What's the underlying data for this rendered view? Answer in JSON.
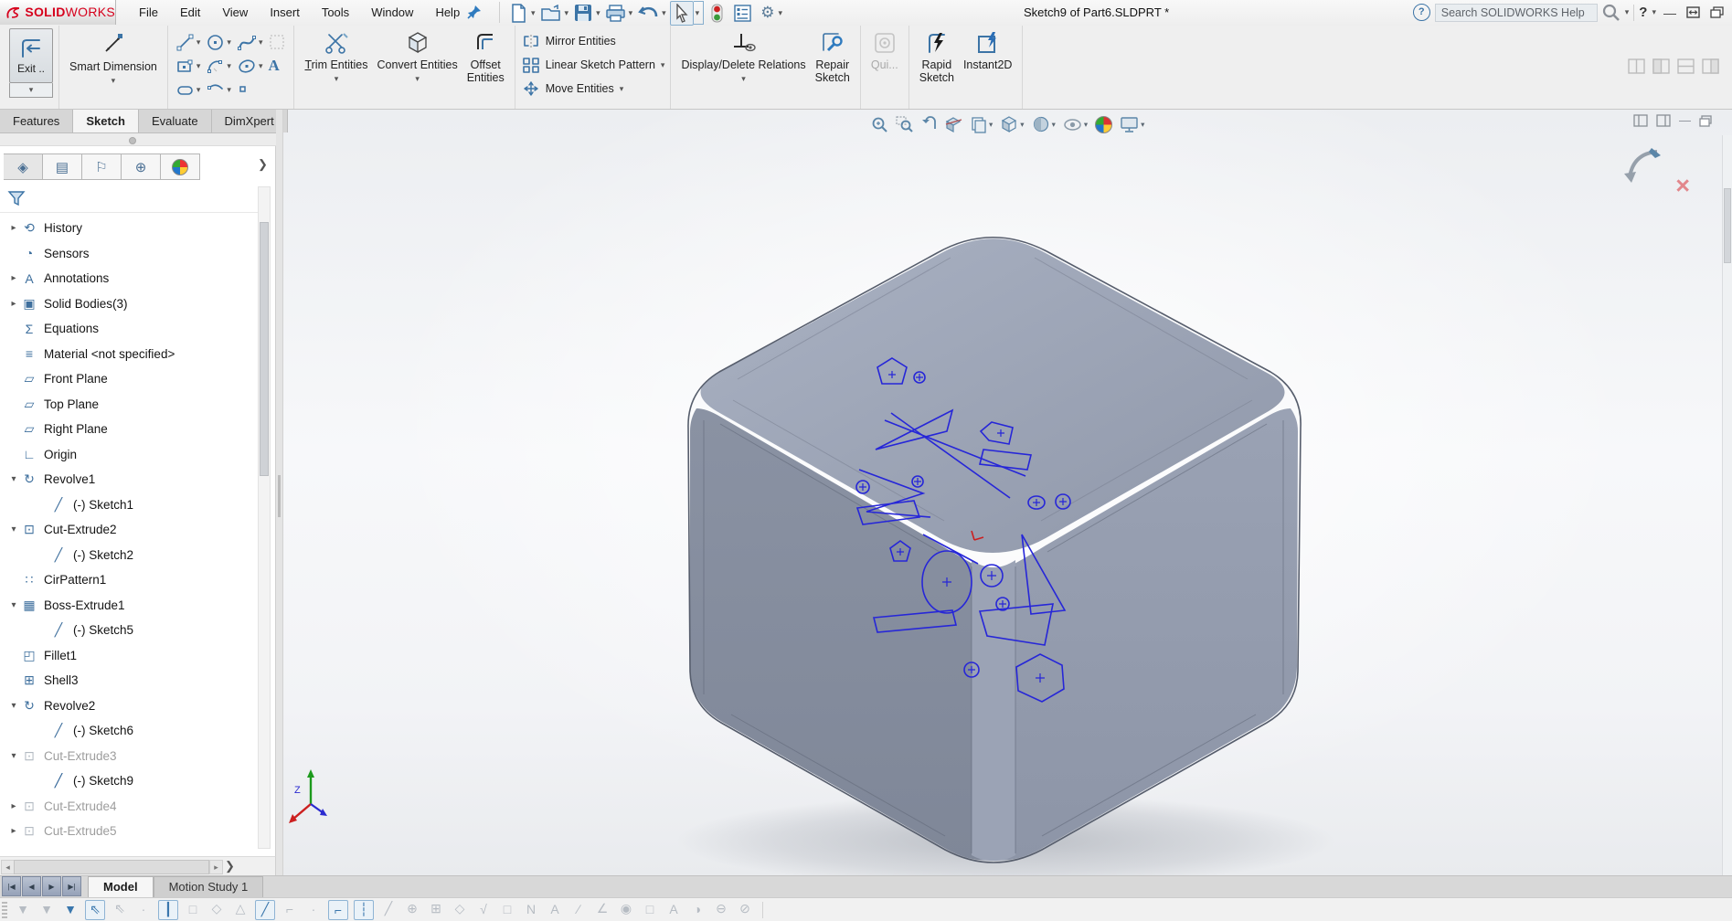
{
  "colors": {
    "logo_red": "#d6001c",
    "icon_blue": "#3c74a6",
    "sketch_blue": "#2626d8",
    "model_gray": "#929aac",
    "accent": "#2a78bd"
  },
  "titlebar": {
    "logo_solid": "SOLID",
    "logo_works": "WORKS",
    "menus": [
      "File",
      "Edit",
      "View",
      "Insert",
      "Tools",
      "Window",
      "Help"
    ],
    "title": "Sketch9 of Part6.SLDPRT *",
    "search_placeholder": "Search SOLIDWORKS Help",
    "help_mark": "?",
    "quickbar_icons": [
      "new",
      "open",
      "save",
      "print",
      "undo",
      "select-arrow",
      "rebuild-traffic-light",
      "file-properties",
      "options-gear"
    ],
    "window_icons": [
      "minimize",
      "resize",
      "cascade-windows"
    ]
  },
  "ribbon": {
    "exit_label": "Exit ..",
    "smart_dimension": "Smart Dimension",
    "trim": "Trim Entities",
    "convert": "Convert Entities",
    "offset_line1": "Offset",
    "offset_line2": "Entities",
    "mirror": "Mirror Entities",
    "linear_pattern": "Linear Sketch Pattern",
    "move": "Move Entities",
    "display_delete": "Display/Delete Relations",
    "repair_line1": "Repair",
    "repair_line2": "Sketch",
    "quick_snaps": "Qui...",
    "rapid_line1": "Rapid",
    "rapid_line2": "Sketch",
    "instant2d": "Instant2D",
    "right_icons": [
      "display-pane-1",
      "display-pane-2",
      "display-pane-3",
      "display-pane-4"
    ]
  },
  "cmd_tabs": [
    {
      "label": "Features",
      "cls": ""
    },
    {
      "label": "Sketch",
      "cls": "active"
    },
    {
      "label": "Evaluate",
      "cls": ""
    },
    {
      "label": "DimXpert",
      "cls": ""
    }
  ],
  "panel_tabs": [
    {
      "glyph": "◈",
      "name": "featuremanager-tab-icon",
      "cls": "sel"
    },
    {
      "glyph": "▤",
      "name": "propertymanager-tab-icon",
      "cls": ""
    },
    {
      "glyph": "⚐",
      "name": "configurationmanager-tab-icon",
      "cls": ""
    },
    {
      "glyph": "⊕",
      "name": "dimxpertmanager-tab-icon",
      "cls": ""
    },
    {
      "glyph": "",
      "name": "displaymanager-tab-icon",
      "cls": "ballt"
    }
  ],
  "tree": {
    "items": [
      {
        "arrow": "▸",
        "glyph": "⟲",
        "label": "History",
        "cls": ""
      },
      {
        "arrow": "",
        "glyph": "◔",
        "label": "Sensors",
        "cls": ""
      },
      {
        "arrow": "▸",
        "glyph": "A",
        "label": "Annotations",
        "cls": ""
      },
      {
        "arrow": "▸",
        "glyph": "▣",
        "label": "Solid Bodies(3)",
        "cls": ""
      },
      {
        "arrow": "",
        "glyph": "Σ",
        "label": "Equations",
        "cls": ""
      },
      {
        "arrow": "",
        "glyph": "≡",
        "label": "Material <not specified>",
        "cls": ""
      },
      {
        "arrow": "",
        "glyph": "▱",
        "label": "Front Plane",
        "cls": ""
      },
      {
        "arrow": "",
        "glyph": "▱",
        "label": "Top Plane",
        "cls": ""
      },
      {
        "arrow": "",
        "glyph": "▱",
        "label": "Right Plane",
        "cls": ""
      },
      {
        "arrow": "",
        "glyph": "∟",
        "label": "Origin",
        "cls": ""
      },
      {
        "arrow": "▾",
        "glyph": "↻",
        "label": "Revolve1",
        "cls": ""
      },
      {
        "arrow": "",
        "glyph": "╱",
        "label": "(-) Sketch1",
        "cls": "ind"
      },
      {
        "arrow": "▾",
        "glyph": "⊡",
        "label": "Cut-Extrude2",
        "cls": ""
      },
      {
        "arrow": "",
        "glyph": "╱",
        "label": "(-) Sketch2",
        "cls": "ind"
      },
      {
        "arrow": "",
        "glyph": "∷",
        "label": "CirPattern1",
        "cls": ""
      },
      {
        "arrow": "▾",
        "glyph": "▦",
        "label": "Boss-Extrude1",
        "cls": ""
      },
      {
        "arrow": "",
        "glyph": "╱",
        "label": "(-) Sketch5",
        "cls": "ind"
      },
      {
        "arrow": "",
        "glyph": "◰",
        "label": "Fillet1",
        "cls": ""
      },
      {
        "arrow": "",
        "glyph": "⊞",
        "label": "Shell3",
        "cls": ""
      },
      {
        "arrow": "▾",
        "glyph": "↻",
        "label": "Revolve2",
        "cls": ""
      },
      {
        "arrow": "",
        "glyph": "╱",
        "label": "(-) Sketch6",
        "cls": "ind"
      },
      {
        "arrow": "▾",
        "glyph": "⊡",
        "label": "Cut-Extrude3",
        "cls": "mut"
      },
      {
        "arrow": "",
        "glyph": "╱",
        "label": "(-) Sketch9",
        "cls": "ind edit"
      },
      {
        "arrow": "▸",
        "glyph": "⊡",
        "label": "Cut-Extrude4",
        "cls": "mut"
      },
      {
        "arrow": "▸",
        "glyph": "⊡",
        "label": "Cut-Extrude5",
        "cls": "mut"
      }
    ]
  },
  "headsup_icons": [
    "zoom-to-fit",
    "zoom-to-area",
    "previous-view",
    "section-view",
    "dynamic-annotation-views",
    "view-orientation",
    "display-style",
    "hide-show-items",
    "edit-appearance",
    "view-settings"
  ],
  "view_window_icons": [
    "pane-left",
    "pane-right",
    "minimize-doc",
    "restore-doc"
  ],
  "confirmation": {
    "accept": "exit-sketch-corner-icon",
    "cancel": "cancel-sketch-icon",
    "cancel_glyph": "×"
  },
  "triad": {
    "z_label": "Z"
  },
  "tab_scroll": [
    "|◀",
    "◀",
    "▶",
    "▶|"
  ],
  "doc_tabs": [
    {
      "label": "Model",
      "cls": "active"
    },
    {
      "label": "Motion Study 1",
      "cls": ""
    }
  ],
  "statusbar": {
    "icons": [
      {
        "glyph": "▼",
        "cls": ""
      },
      {
        "glyph": "▼",
        "cls": ""
      },
      {
        "glyph": "▼",
        "cls": "blue"
      },
      {
        "glyph": "⇖",
        "cls": "box"
      },
      {
        "glyph": "⇖",
        "cls": ""
      },
      {
        "glyph": "·",
        "cls": ""
      },
      {
        "glyph": "┃",
        "cls": "box"
      },
      {
        "glyph": "□",
        "cls": ""
      },
      {
        "glyph": "◇",
        "cls": ""
      },
      {
        "glyph": "△",
        "cls": ""
      },
      {
        "glyph": "╱",
        "cls": "box"
      },
      {
        "glyph": "⌐",
        "cls": ""
      },
      {
        "glyph": "·",
        "cls": ""
      },
      {
        "glyph": "⌐",
        "cls": "box"
      },
      {
        "glyph": "┆",
        "cls": "box"
      },
      {
        "glyph": "╱",
        "cls": ""
      },
      {
        "glyph": "⊕",
        "cls": ""
      },
      {
        "glyph": "⊞",
        "cls": ""
      },
      {
        "glyph": "◇",
        "cls": ""
      },
      {
        "glyph": "√",
        "cls": ""
      },
      {
        "glyph": "□",
        "cls": ""
      },
      {
        "glyph": "N",
        "cls": ""
      },
      {
        "glyph": "A",
        "cls": ""
      },
      {
        "glyph": "∕",
        "cls": ""
      },
      {
        "glyph": "∠",
        "cls": ""
      },
      {
        "glyph": "◉",
        "cls": ""
      },
      {
        "glyph": "□",
        "cls": ""
      },
      {
        "glyph": "A",
        "cls": ""
      },
      {
        "glyph": "◑",
        "cls": ""
      },
      {
        "glyph": "⊖",
        "cls": ""
      },
      {
        "glyph": "⊘",
        "cls": ""
      }
    ]
  }
}
